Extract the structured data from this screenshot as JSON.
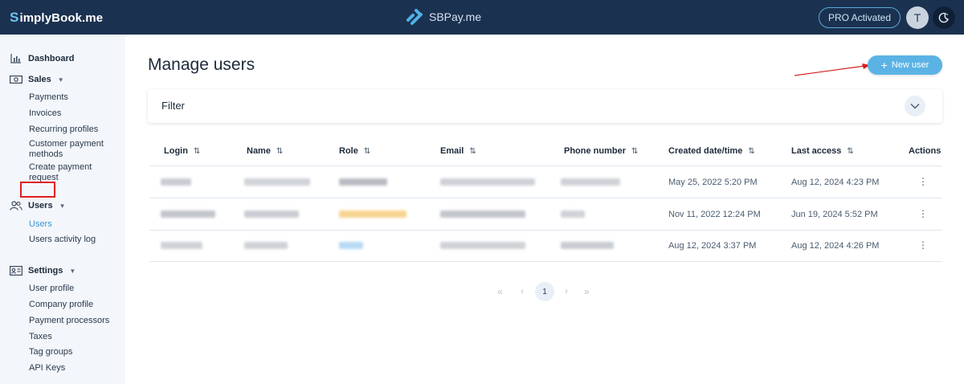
{
  "header": {
    "brand_prefix": "S",
    "brand_rest": "implyBook.me",
    "center_logo": "SBPay.me",
    "pro_button": "PRO Activated",
    "avatar_initial": "T"
  },
  "sidebar": {
    "dashboard": "Dashboard",
    "sales": "Sales",
    "sales_items": [
      "Payments",
      "Invoices",
      "Recurring profiles",
      "Customer payment methods",
      "Create payment request"
    ],
    "users": "Users",
    "users_items": [
      "Users",
      "Users activity log"
    ],
    "settings": "Settings",
    "settings_items": [
      "User profile",
      "Company profile",
      "Payment processors",
      "Taxes",
      "Tag groups",
      "API Keys"
    ]
  },
  "main": {
    "title": "Manage users",
    "new_user_label": "New user",
    "filter_label": "Filter"
  },
  "table": {
    "columns": [
      "Login",
      "Name",
      "Role",
      "Email",
      "Phone number",
      "Created date/time",
      "Last access",
      "Actions"
    ],
    "rows": [
      {
        "created": "May 25, 2022 5:20 PM",
        "last_access": "Aug 12, 2024 4:23 PM"
      },
      {
        "created": "Nov 11, 2022 12:24 PM",
        "last_access": "Jun 19, 2024 5:52 PM"
      },
      {
        "created": "Aug 12, 2024 3:37 PM",
        "last_access": "Aug 12, 2024 4:26 PM"
      }
    ]
  },
  "pagination": {
    "first": "«",
    "prev": "‹",
    "current": "1",
    "next": "›",
    "last": "»"
  },
  "colors": {
    "topbar": "#1b3150",
    "accent": "#5bb3e5",
    "active_link": "#3a98d6",
    "highlight_box": "#e02020"
  }
}
